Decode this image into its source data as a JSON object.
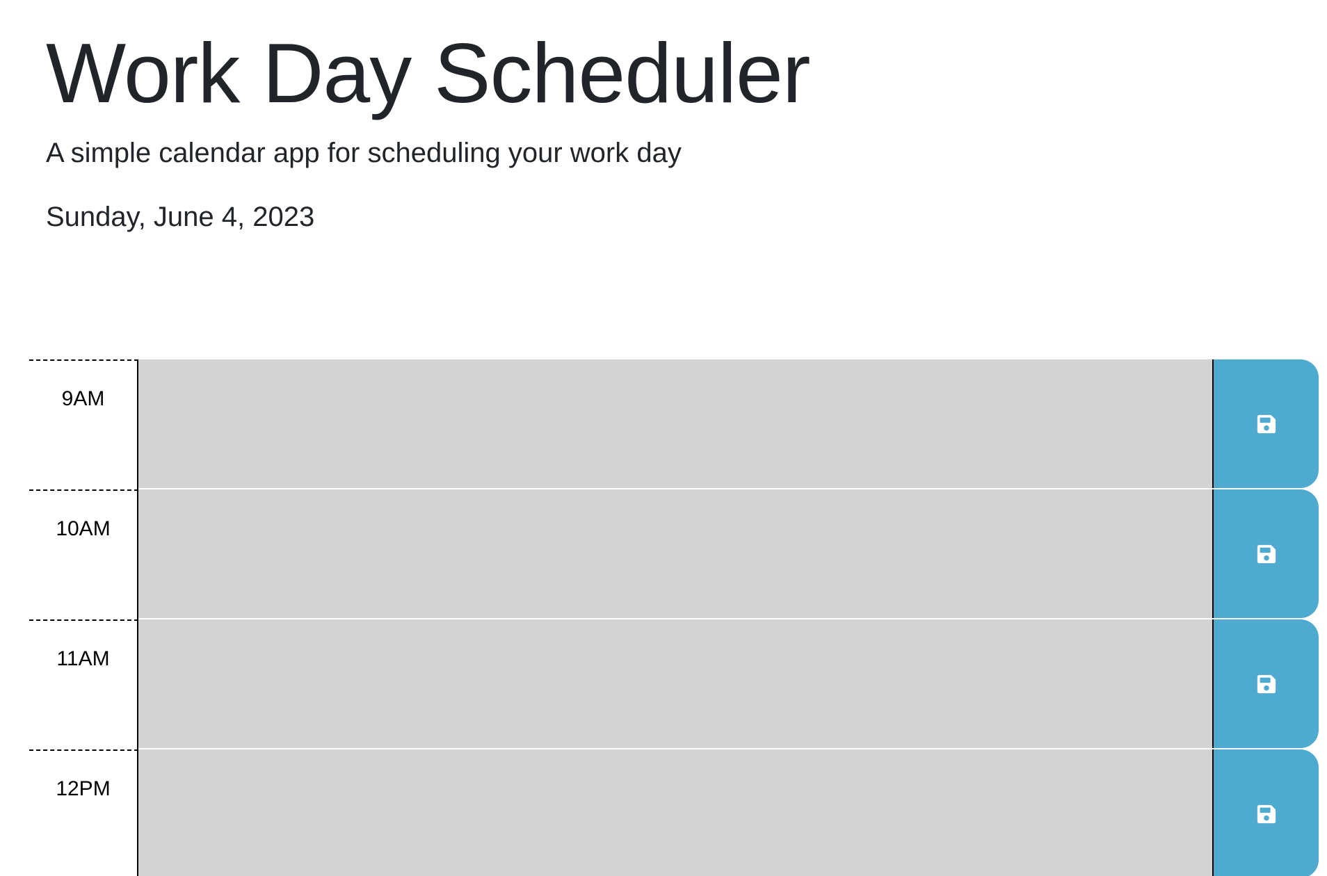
{
  "header": {
    "title": "Work Day Scheduler",
    "subtitle": "A simple calendar app for scheduling your work day",
    "current_day": "Sunday, June 4, 2023"
  },
  "schedule": {
    "rows": [
      {
        "hour": "9AM",
        "text": ""
      },
      {
        "hour": "10AM",
        "text": ""
      },
      {
        "hour": "11AM",
        "text": ""
      },
      {
        "hour": "12PM",
        "text": ""
      }
    ]
  },
  "colors": {
    "past_block": "#d3d3d3",
    "save_button": "#4faacf",
    "save_icon": "#ffffff"
  },
  "icons": {
    "save": "floppy-disk-icon"
  }
}
